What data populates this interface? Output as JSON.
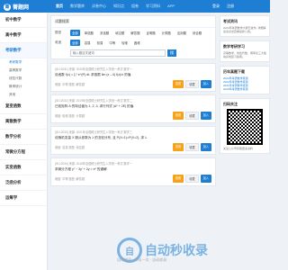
{
  "topbar": {
    "logo_text": "菁题网",
    "nav": [
      "首页",
      "数学题库",
      "试卷中心",
      "知识点",
      "组卷",
      "学习资料",
      "APP"
    ],
    "right_links": [
      "登录",
      "注册"
    ]
  },
  "sidebar": {
    "items": [
      "初中数学",
      "高中数学",
      "考研数学"
    ],
    "sub_items": [
      "考研数学",
      "高等数学",
      "线性代数",
      "概率统计",
      "其他"
    ],
    "more_items": [
      "复变函数",
      "离散数学",
      "数学分析",
      "常微分方程",
      "实变函数",
      "泛函分析",
      "运筹学"
    ]
  },
  "filter": {
    "title": "试题搜索",
    "row1_label": "题型",
    "row1": [
      "全部",
      "单选题",
      "多选题",
      "填空题",
      "解答题",
      "证明题",
      "计算题",
      "应用题",
      "综合题"
    ],
    "row2_label": "难度",
    "row2": [
      "全部",
      "容易",
      "较易",
      "中等",
      "较难",
      "困难"
    ],
    "search_placeholder": "输入题目关键词",
    "search_btn": "搜"
  },
  "questions": [
    {
      "meta": "[ID:12031] 来源: 2020年全国硕士研究生入学统一考试 数学一",
      "body": "设函数 f(x) = ∫₀ˣ e^{t²} dt, 求极限 lim (x→0) f(x)/x 的值.",
      "foot": "难度: 中等  题型: 解答题"
    },
    {
      "meta": "[ID:12032] 来源: 2019年全国硕士研究生入学统一考试 数学二",
      "body": "已知矩阵 A 的特征值为 1, 2, 3, 求行列式 |A* + 2E| 的值.",
      "foot": "难度: 较难  题型: 计算题"
    },
    {
      "meta": "[ID:12033] 来源: 2021年全国硕士研究生入学统一考试 数学三",
      "body": "设随机变量 X 服从参数为 λ 的泊松分布, 且 P(X=1)=P(X=2), 求 λ.",
      "foot": "难度: 容易  题型: 填空题"
    },
    {
      "meta": "[ID:12034] 来源: 2018年全国硕士研究生入学统一考试 数学一",
      "body": "求微分方程 y″ − 3y′ + 2y = eˣ 的通解.",
      "foot": "难度: 中等  题型: 解答题"
    }
  ],
  "q_buttons": {
    "detail": "查看",
    "collect": "收藏",
    "add": "加入"
  },
  "right": {
    "card1_title": "考试资讯",
    "card1_text": "2024年考研数学大纲已发布, 详细解读请点击查看最新公告。",
    "card2_title": "数学考研学习",
    "card2_text": "高等数学、线性代数、概率论三大板块系统复习指南。",
    "card3_title": "历年真题下载",
    "card3_links": [
      "2023年考研数学真题",
      "2022年考研数学真题",
      "2021年考研数学真题",
      "2020年考研数学真题"
    ],
    "card4_title": "扫码关注",
    "card4_text": "关注公众号获取更多资料"
  },
  "watermark": {
    "mark": "自",
    "text": "自动秒收录",
    "sub": "自动收录 · 来访一次 · 自动收录"
  }
}
